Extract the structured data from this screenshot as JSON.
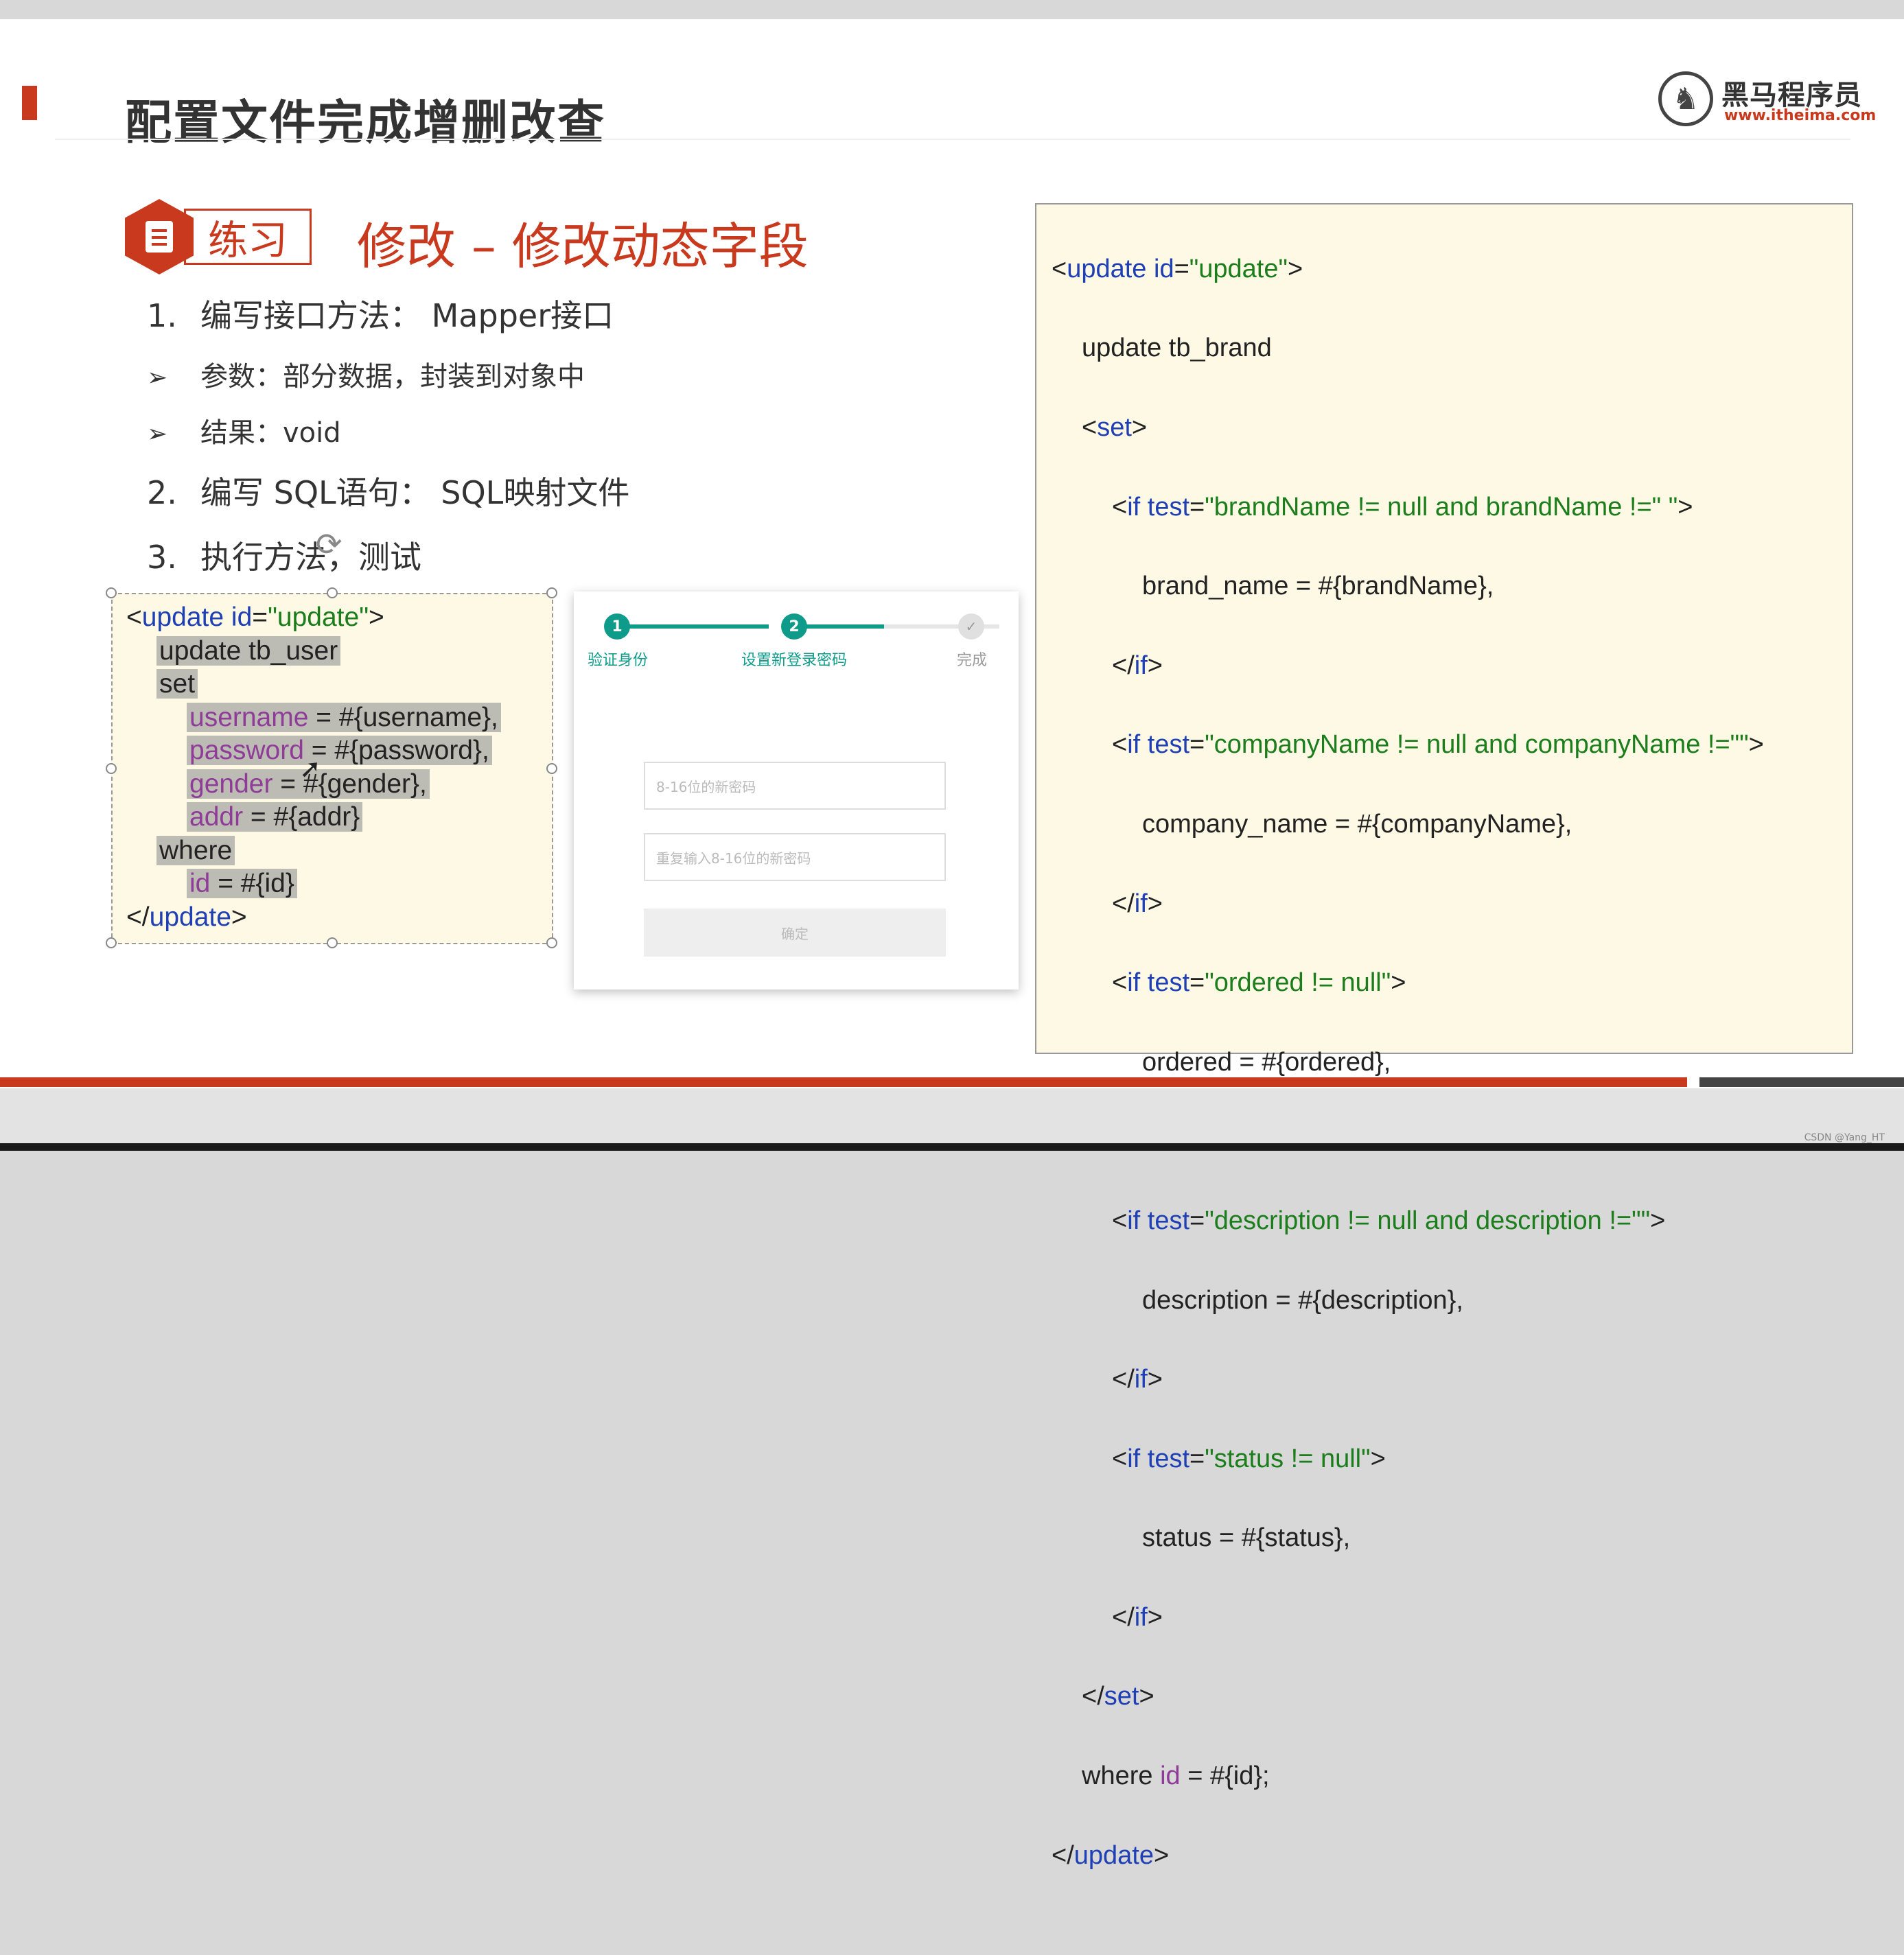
{
  "slide": {
    "title": "配置文件完成增删改查",
    "logo": {
      "name": "黑马程序员",
      "url": "www.itheima.com",
      "icon": "horse-logo-icon"
    },
    "badge_label": "练习",
    "subtitle": "修改 – 修改动态字段",
    "list": [
      {
        "marker": "1.",
        "text": "编写接口方法： Mapper接口"
      },
      {
        "marker": "➢",
        "text": "参数：部分数据，封装到对象中"
      },
      {
        "marker": "➢",
        "text": "结果：void"
      },
      {
        "marker": "2.",
        "text": "编写 SQL语句： SQL映射文件"
      },
      {
        "marker": "3.",
        "text": "执行方法，测试"
      }
    ]
  },
  "code_left": {
    "l1_open": "<",
    "l1_tag": "update",
    "l1_attr": " id",
    "l1_eq": "=",
    "l1_val": "\"update\"",
    "l1_close": ">",
    "l2": "update tb_user",
    "l3": "set",
    "l4_field": "username",
    "l4_rest": " = #{username},",
    "l5_field": "password",
    "l5_rest": " = #{password},",
    "l6_field": "gender",
    "l6_rest": " = #{gender},",
    "l7_field": "addr",
    "l7_rest": " = #{addr}",
    "l8": "where",
    "l9_field": "id",
    "l9_rest": " = #{id}",
    "l10_open": "</",
    "l10_tag": "update",
    "l10_close": ">"
  },
  "form": {
    "steps": [
      {
        "num": "1",
        "label": "验证身份"
      },
      {
        "num": "2",
        "label": "设置新登录密码"
      },
      {
        "num": "✓",
        "label": "完成"
      }
    ],
    "password_placeholder": "8-16位的新密码",
    "repeat_placeholder": "重复输入8-16位的新密码",
    "confirm_label": "确定"
  },
  "code_right": {
    "r1_tag": "update",
    "r1_attr": " id",
    "r1_val": "\"update\"",
    "r2": "update tb_brand",
    "r3_tag": "set",
    "r4_val": "\"brandName != null and brandName !=\" \"",
    "r5": "brand_name = #{brandName},",
    "r7_val": "\"companyName != null and companyName !=\"\"",
    "r8": "company_name = #{companyName},",
    "r10_val": "\"ordered != null\"",
    "r11": "ordered = #{ordered},",
    "r13_val": "\"description != null and description !=\"\"",
    "r14": "description = #{description},",
    "r16_val": "\"status != null\"",
    "r17": "status = #{status},",
    "if_tag": "if",
    "test_attr": " test",
    "r20_where": "where ",
    "r20_id": "id",
    "r20_rest": " = #{id};",
    "r21_tag": "update"
  },
  "watermark": "CSDN @Yang_HT",
  "colors": {
    "accent": "#c9391e",
    "code_bg": "#fdf9e4",
    "teal": "#0e9b8a",
    "keyword_blue": "#1f3fb5",
    "value_green": "#1b7d1b",
    "field_purple": "#8e3c98"
  }
}
